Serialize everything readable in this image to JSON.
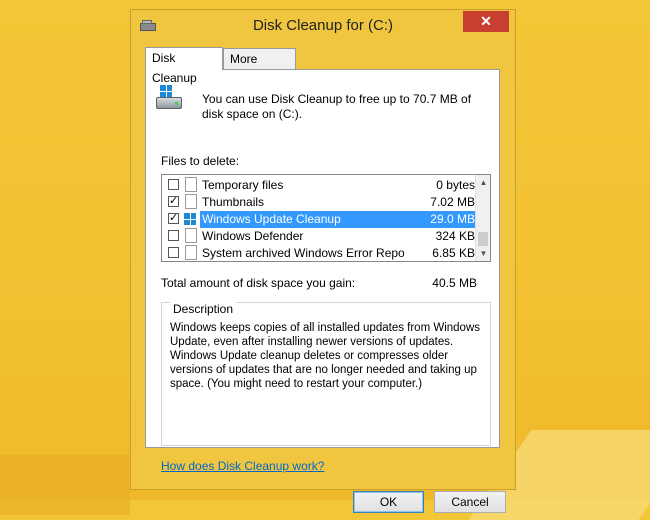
{
  "window": {
    "title": "Disk Cleanup for  (C:)",
    "close_glyph": "✕"
  },
  "tabs": [
    {
      "label": "Disk Cleanup",
      "active": true
    },
    {
      "label": "More Options",
      "active": false
    }
  ],
  "intro_text": "You can use Disk Cleanup to free up to 70.7 MB of disk space on  (C:).",
  "files_label": "Files to delete:",
  "files": [
    {
      "label": "Temporary files",
      "size": "0 bytes",
      "checked": false,
      "selected": false,
      "icon": "file-icon"
    },
    {
      "label": "Thumbnails",
      "size": "7.02 MB",
      "checked": true,
      "selected": false,
      "icon": "file-icon"
    },
    {
      "label": "Windows Update Cleanup",
      "size": "29.0 MB",
      "checked": true,
      "selected": true,
      "icon": "windows-logo-icon"
    },
    {
      "label": "Windows Defender",
      "size": "324 KB",
      "checked": false,
      "selected": false,
      "icon": "file-icon"
    },
    {
      "label": "System archived Windows Error Repor...",
      "size": "6.85 KB",
      "checked": false,
      "selected": false,
      "icon": "file-icon"
    }
  ],
  "check_glyph": "✓",
  "scroll": {
    "up": "▲",
    "down": "▼"
  },
  "total": {
    "label": "Total amount of disk space you gain:",
    "value": "40.5 MB"
  },
  "description": {
    "legend": "Description",
    "text": "Windows keeps copies of all installed updates from Windows Update, even after installing newer versions of updates. Windows Update cleanup deletes or compresses older versions of updates that are no longer needed and taking up space. (You might need to restart your computer.)"
  },
  "help_link": "How does Disk Cleanup work?",
  "buttons": {
    "ok": "OK",
    "cancel": "Cancel"
  },
  "colors": {
    "selection": "#3399ff",
    "close_button": "#c7402f",
    "link": "#0066cc"
  }
}
